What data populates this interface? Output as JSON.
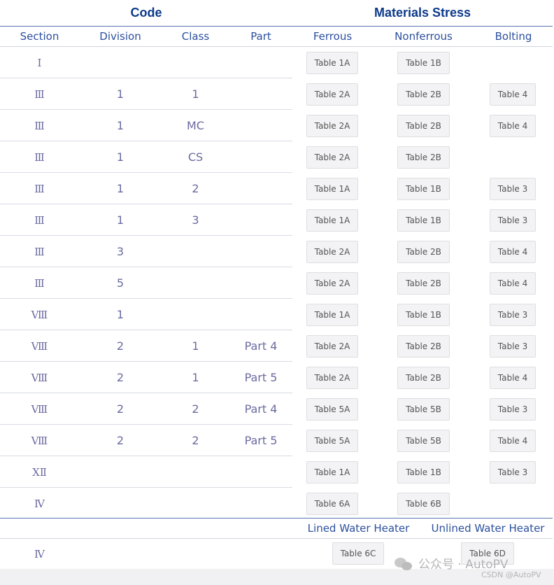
{
  "headers": {
    "code": "Code",
    "materials": "Materials Stress",
    "section": "Section",
    "division": "Division",
    "class": "Class",
    "part": "Part",
    "ferrous": "Ferrous",
    "nonferrous": "Nonferrous",
    "bolting": "Bolting",
    "lined": "Lined Water Heater",
    "unlined": "Unlined Water Heater"
  },
  "rows": [
    {
      "section": "Ⅰ",
      "division": "",
      "class": "",
      "part": "",
      "ferrous": "Table 1A",
      "nonferrous": "Table 1B",
      "bolting": ""
    },
    {
      "section": "Ⅲ",
      "division": "1",
      "class": "1",
      "part": "",
      "ferrous": "Table 2A",
      "nonferrous": "Table 2B",
      "bolting": "Table 4"
    },
    {
      "section": "Ⅲ",
      "division": "1",
      "class": "MC",
      "part": "",
      "ferrous": "Table 2A",
      "nonferrous": "Table 2B",
      "bolting": "Table 4"
    },
    {
      "section": "Ⅲ",
      "division": "1",
      "class": "CS",
      "part": "",
      "ferrous": "Table 2A",
      "nonferrous": "Table 2B",
      "bolting": ""
    },
    {
      "section": "Ⅲ",
      "division": "1",
      "class": "2",
      "part": "",
      "ferrous": "Table 1A",
      "nonferrous": "Table 1B",
      "bolting": "Table 3"
    },
    {
      "section": "Ⅲ",
      "division": "1",
      "class": "3",
      "part": "",
      "ferrous": "Table 1A",
      "nonferrous": "Table 1B",
      "bolting": "Table 3"
    },
    {
      "section": "Ⅲ",
      "division": "3",
      "class": "",
      "part": "",
      "ferrous": "Table 2A",
      "nonferrous": "Table 2B",
      "bolting": "Table 4"
    },
    {
      "section": "Ⅲ",
      "division": "5",
      "class": "",
      "part": "",
      "ferrous": "Table 2A",
      "nonferrous": "Table 2B",
      "bolting": "Table 4"
    },
    {
      "section": "Ⅷ",
      "division": "1",
      "class": "",
      "part": "",
      "ferrous": "Table 1A",
      "nonferrous": "Table 1B",
      "bolting": "Table 3"
    },
    {
      "section": "Ⅷ",
      "division": "2",
      "class": "1",
      "part": "Part 4",
      "ferrous": "Table 2A",
      "nonferrous": "Table 2B",
      "bolting": "Table 3"
    },
    {
      "section": "Ⅷ",
      "division": "2",
      "class": "1",
      "part": "Part 5",
      "ferrous": "Table 2A",
      "nonferrous": "Table 2B",
      "bolting": "Table 4"
    },
    {
      "section": "Ⅷ",
      "division": "2",
      "class": "2",
      "part": "Part 4",
      "ferrous": "Table 5A",
      "nonferrous": "Table 5B",
      "bolting": "Table 3"
    },
    {
      "section": "Ⅷ",
      "division": "2",
      "class": "2",
      "part": "Part 5",
      "ferrous": "Table 5A",
      "nonferrous": "Table 5B",
      "bolting": "Table 4"
    },
    {
      "section": "XⅡ",
      "division": "",
      "class": "",
      "part": "",
      "ferrous": "Table 1A",
      "nonferrous": "Table 1B",
      "bolting": "Table 3"
    },
    {
      "section": "Ⅳ",
      "division": "",
      "class": "",
      "part": "",
      "ferrous": "Table 6A",
      "nonferrous": "Table 6B",
      "bolting": ""
    }
  ],
  "water_heater_row": {
    "section": "Ⅳ",
    "lined": "Table 6C",
    "unlined": "Table 6D"
  },
  "watermark": {
    "text": "公众号 · AutoPV",
    "credit": "CSDN @AutoPV"
  }
}
